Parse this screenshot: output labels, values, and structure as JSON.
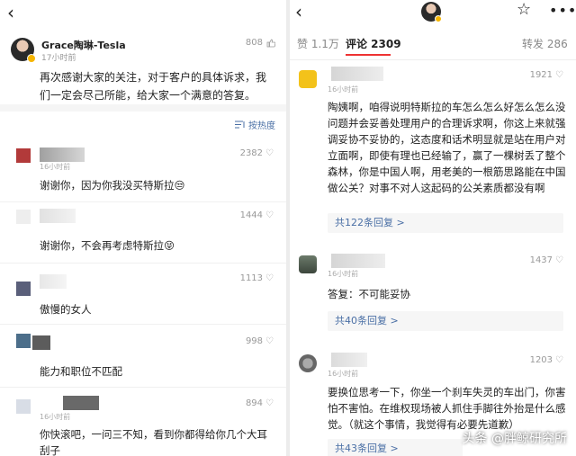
{
  "left": {
    "post": {
      "author": "Grace陶琳-Tesla",
      "time": "17小时前",
      "likes": "808",
      "body": "再次感谢大家的关注，对于客户的具体诉求，我们一定会尽己所能，给大家一个满意的答复。"
    },
    "sort_label": "按热度",
    "comments": [
      {
        "time": "16小时前",
        "likes": "2382",
        "text": "谢谢你，因为你我没买特斯拉😒"
      },
      {
        "time": "",
        "likes": "1444",
        "text": "谢谢你，不会再考虑特斯拉😝"
      },
      {
        "time": "",
        "likes": "1113",
        "text": "傲慢的女人"
      },
      {
        "time": "",
        "likes": "998",
        "text": "能力和职位不匹配"
      },
      {
        "time": "16小时前",
        "likes": "894",
        "text": "你快滚吧，一问三不知，看到你都得给你几个大耳刮子"
      }
    ]
  },
  "right": {
    "tabs": [
      {
        "label": "赞 1.1万"
      },
      {
        "label": "评论 2309"
      },
      {
        "label": "转发 286"
      }
    ],
    "comments": [
      {
        "time": "16小时前",
        "likes": "1921",
        "text": "陶姨啊，咱得说明特斯拉的车怎么怎么好怎么怎么没问题并会妥善处理用户的合理诉求啊，你这上来就强调妥协不妥协的，这态度和话术明显就是站在用户对立面啊，即使有理也已经输了，赢了一棵树丢了整个森林，你是中国人啊，用老美的一根筋思路能在中国做公关？对事不对人这起码的公关素质都没有啊",
        "replies": "共122条回复 >"
      },
      {
        "time": "16小时前",
        "likes": "1437",
        "text": "答复：不可能妥协",
        "replies": "共40条回复 >"
      },
      {
        "time": "16小时前",
        "likes": "1203",
        "text": "要换位思考一下，你坐一个刹车失灵的车出门，你害怕不害怕。在维权现场被人抓住手脚往外抬是什么感觉。（就这个事情，我觉得有必要先道歉）",
        "replies": "共43条回复 >"
      }
    ],
    "watermark": "头条 @胖鲸研究所"
  }
}
